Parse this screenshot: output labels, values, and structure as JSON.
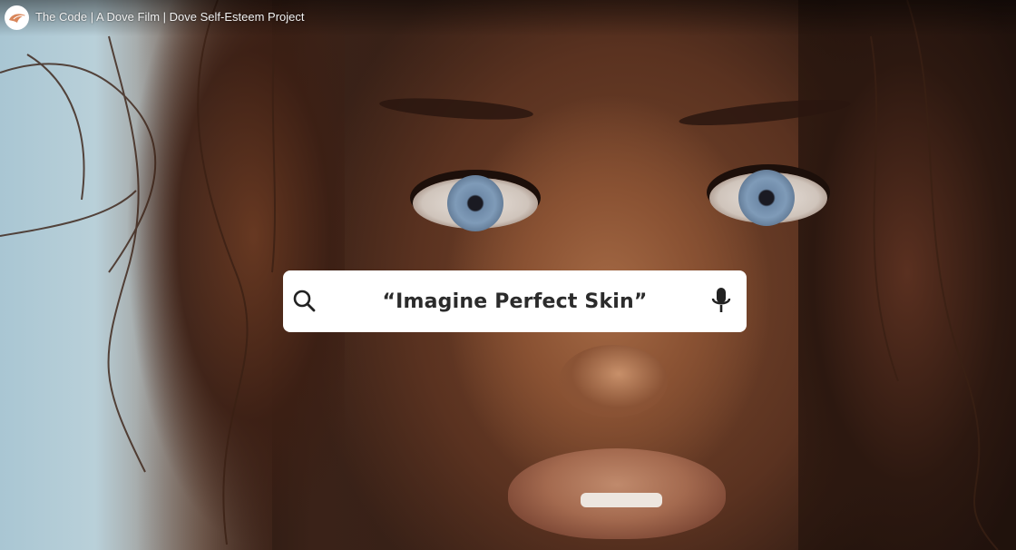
{
  "video": {
    "title": "The Code | A Dove Film | Dove Self-Esteem Project"
  },
  "overlay": {
    "search_query": "“Imagine Perfect Skin”",
    "left_icon": "search-icon",
    "right_icon": "microphone-icon"
  },
  "colors": {
    "search_bar_bg": "#ffffff",
    "query_text": "#2b2b2b",
    "avatar_bg": "#ffffff",
    "logo_accent": "#d9865a"
  }
}
